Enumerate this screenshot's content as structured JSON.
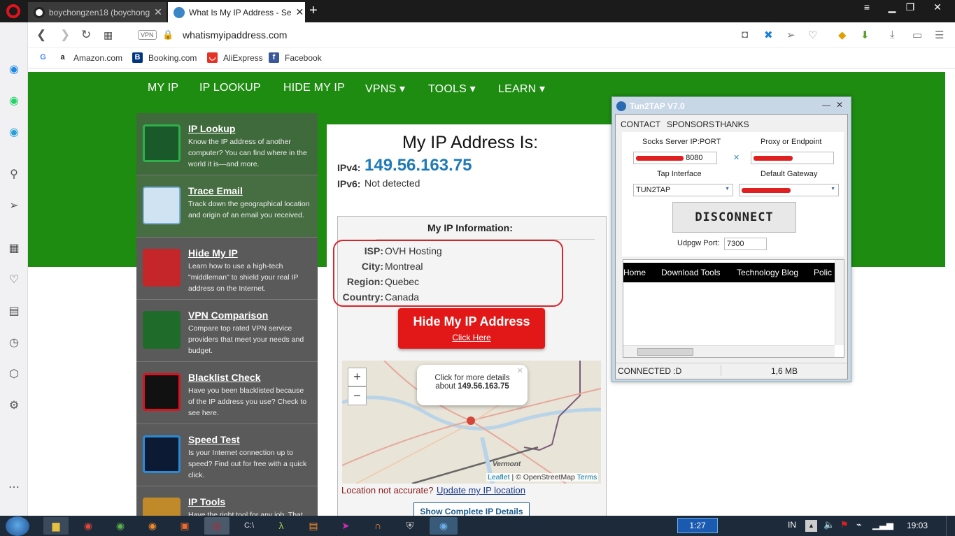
{
  "browser": {
    "tabs": [
      {
        "title": "boychongzen18 (boychong",
        "active": false
      },
      {
        "title": "What Is My IP Address - Se",
        "active": true
      }
    ],
    "url": "whatismyipaddress.com",
    "vpn_badge": "VPN",
    "bookmarks": [
      "Amazon.com",
      "Booking.com",
      "AliExpress",
      "Facebook"
    ]
  },
  "site": {
    "nav": [
      "MY IP",
      "IP LOOKUP",
      "HIDE MY IP",
      "VPNS ▾",
      "TOOLS ▾",
      "LEARN ▾"
    ],
    "sidebar": [
      {
        "title": "IP Lookup",
        "desc": "Know the IP address of another computer? You can find where in the world it is—and more."
      },
      {
        "title": "Trace Email",
        "desc": "Track down the geographical location and origin of an email you received."
      },
      {
        "title": "Hide My IP",
        "desc": "Learn how to use a high-tech \"middleman\" to shield your real IP address on the Internet."
      },
      {
        "title": "VPN Comparison",
        "desc": "Compare top rated VPN service providers that meet your needs and budget."
      },
      {
        "title": "Blacklist Check",
        "desc": "Have you been blacklisted because of the IP address you use? Check to see here."
      },
      {
        "title": "Speed Test",
        "desc": "Is your Internet connection up to speed? Find out for free with a quick click."
      },
      {
        "title": "IP Tools",
        "desc": "Have the right tool for any job. That"
      }
    ],
    "heading": "My IP Address Is:",
    "ipv4_label": "IPv4:",
    "ipv4": "149.56.163.75",
    "ipv6_label": "IPv6:",
    "ipv6": "Not detected",
    "info_title": "My IP Information:",
    "info": [
      {
        "label": "ISP:",
        "value": "OVH Hosting"
      },
      {
        "label": "City:",
        "value": "Montreal"
      },
      {
        "label": "Region:",
        "value": "Quebec"
      },
      {
        "label": "Country:",
        "value": "Canada"
      }
    ],
    "hide_btn": {
      "title": "Hide My IP Address",
      "link": "Click Here"
    },
    "map": {
      "popup_line1": "Click for more details",
      "popup_about": "about",
      "popup_ip": "149.56.163.75",
      "place": "Vermont",
      "attrib_leaflet": "Leaflet",
      "attrib_osm": "| © OpenStreetMap",
      "attrib_terms": "Terms",
      "zoom_in": "+",
      "zoom_out": "−"
    },
    "accuracy_text": "Location not accurate?",
    "accuracy_link": "Update my IP location",
    "details_btn": "Show Complete IP Details"
  },
  "tun2tap": {
    "title": "Tun2TAP V7.0",
    "menu": [
      "CONTACT",
      "SPONSORS",
      "THANKS"
    ],
    "socks_label": "Socks Server IP:PORT",
    "socks_port": "8080",
    "proxy_label": "Proxy or Endpoint",
    "tap_label": "Tap Interface",
    "tap_value": "TUN2TAP",
    "gateway_label": "Default Gateway",
    "disconnect": "DISCONNECT",
    "udpgw_label": "Udpgw Port:",
    "udpgw_value": "7300",
    "browser_links": [
      "Home",
      "Download Tools",
      "Technology Blog",
      "Polic"
    ],
    "status": "CONNECTED :D",
    "size": "1,6 MB"
  },
  "taskbar": {
    "badge": "1:27",
    "lang": "IN",
    "time": "19:03"
  }
}
